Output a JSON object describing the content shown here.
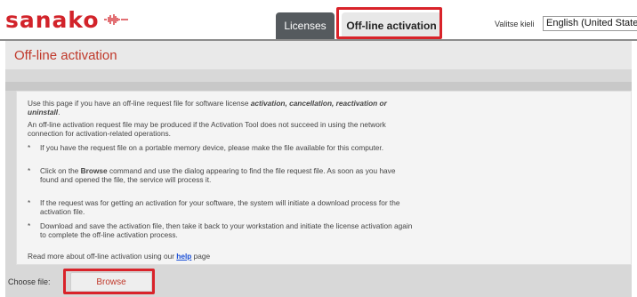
{
  "brand": {
    "logo_text": "sanako"
  },
  "nav": {
    "tabs": [
      {
        "label": "Licenses"
      },
      {
        "label": "Off-line activation"
      }
    ]
  },
  "language": {
    "label": "Valitse kieli",
    "selected": "English (United States)"
  },
  "page": {
    "title": "Off-line activation"
  },
  "content": {
    "intro_prefix": "Use this page if you have an off-line request file for software license ",
    "intro_bold": "activation, cancellation, reactivation or uninstall",
    "intro_suffix": ".",
    "paragraph2": "An off-line activation request file may be produced if the Activation Tool does not succeed in using the network connection for activation-related operations.",
    "bullets": [
      {
        "mark": "*",
        "text": "If you have the request file on a portable memory device, please make the file available for this computer."
      },
      {
        "mark": "*",
        "text_prefix": "Click on the ",
        "text_bold": "Browse",
        "text_suffix": " command and use the dialog appearing to find the file request file. As soon as you have found and opened the file, the service will process it."
      },
      {
        "mark": "*",
        "text": "If the request was for getting an activation for your software, the system will initiate a download process for the activation file."
      },
      {
        "mark": "*",
        "text": "Download and save the activation file, then take it back to your workstation and initiate the license activation again to complete the off-line activation process."
      }
    ],
    "help_prefix": "Read more about off-line activation using our ",
    "help_link": "help",
    "help_suffix": " page"
  },
  "footer": {
    "choose_label": "Choose file:",
    "browse_label": "Browse"
  },
  "colors": {
    "brand_red": "#d2232a",
    "title_red": "#c0392b",
    "link_blue": "#1a4fd6",
    "tab_dark": "#555a5e"
  }
}
